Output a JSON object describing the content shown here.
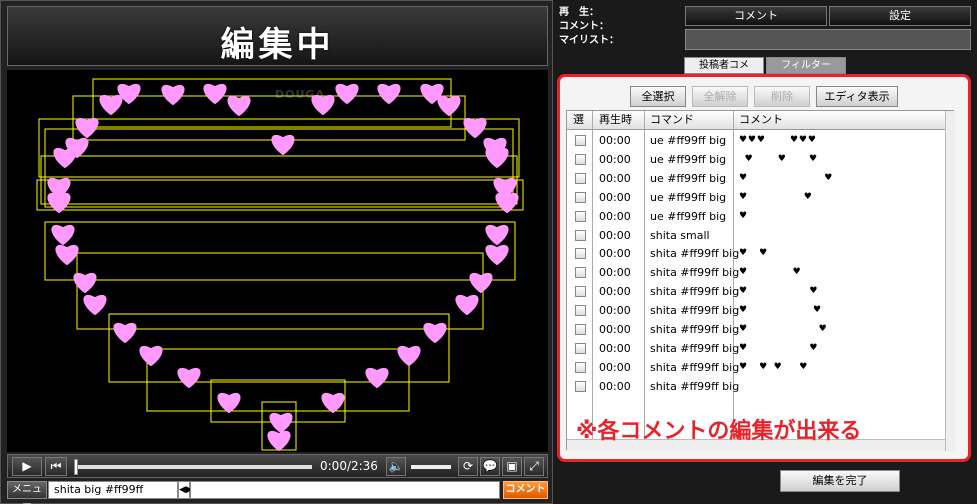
{
  "header": {
    "title": "編集中"
  },
  "player": {
    "watermark": "DOUGA",
    "time": "0:00/2:36",
    "menu_label": "メニュー",
    "command_value": "shita big #ff99ff",
    "comment_button": "コメント"
  },
  "info": {
    "playback_label": "再　生：",
    "comment_label": "コメント：",
    "mylist_label": "マイリスト："
  },
  "top_buttons": {
    "comment": "コメント",
    "settings": "設定"
  },
  "tabs": {
    "poster": "投稿者コメ",
    "filter": "フィルター"
  },
  "toolbar": {
    "select_all": "全選択",
    "deselect_all": "全解除",
    "delete": "削除",
    "editor_view": "エディタ表示"
  },
  "table": {
    "headers": {
      "select": "選",
      "time": "再生時",
      "command": "コマンド",
      "comment": "コメント"
    },
    "rows": [
      {
        "time": "00:00",
        "command": "ue #ff99ff big",
        "comment": "♥ ♥ ♥              ♥ ♥ ♥"
      },
      {
        "time": "00:00",
        "command": "ue #ff99ff big",
        "comment": "   ♥              ♥             ♥"
      },
      {
        "time": "00:00",
        "command": "ue #ff99ff big",
        "comment": "♥                                          ♥"
      },
      {
        "time": "00:00",
        "command": "ue #ff99ff big",
        "comment": "♥                               ♥"
      },
      {
        "time": "00:00",
        "command": "ue #ff99ff big",
        "comment": "♥"
      },
      {
        "time": "00:00",
        "command": "shita small",
        "comment": ""
      },
      {
        "time": "00:00",
        "command": "shita #ff99ff big",
        "comment": "♥       ♥"
      },
      {
        "time": "00:00",
        "command": "shita #ff99ff big",
        "comment": "♥                         ♥"
      },
      {
        "time": "00:00",
        "command": "shita #ff99ff big",
        "comment": "♥                                  ♥"
      },
      {
        "time": "00:00",
        "command": "shita #ff99ff big",
        "comment": "♥                                    ♥"
      },
      {
        "time": "00:00",
        "command": "shita #ff99ff big",
        "comment": "♥                                       ♥"
      },
      {
        "time": "00:00",
        "command": "shita #ff99ff big",
        "comment": "♥                                  ♥"
      },
      {
        "time": "00:00",
        "command": "shita #ff99ff big",
        "comment": "♥       ♥    ♥          ♥"
      },
      {
        "time": "00:00",
        "command": "shita #ff99ff big",
        "comment": ""
      }
    ]
  },
  "note": "※各コメントの編集が出来る",
  "finish_button": "編集を完了",
  "colors": {
    "heart": "#ff99ff",
    "accent": "#e8232a",
    "guide": "#ffff00"
  }
}
